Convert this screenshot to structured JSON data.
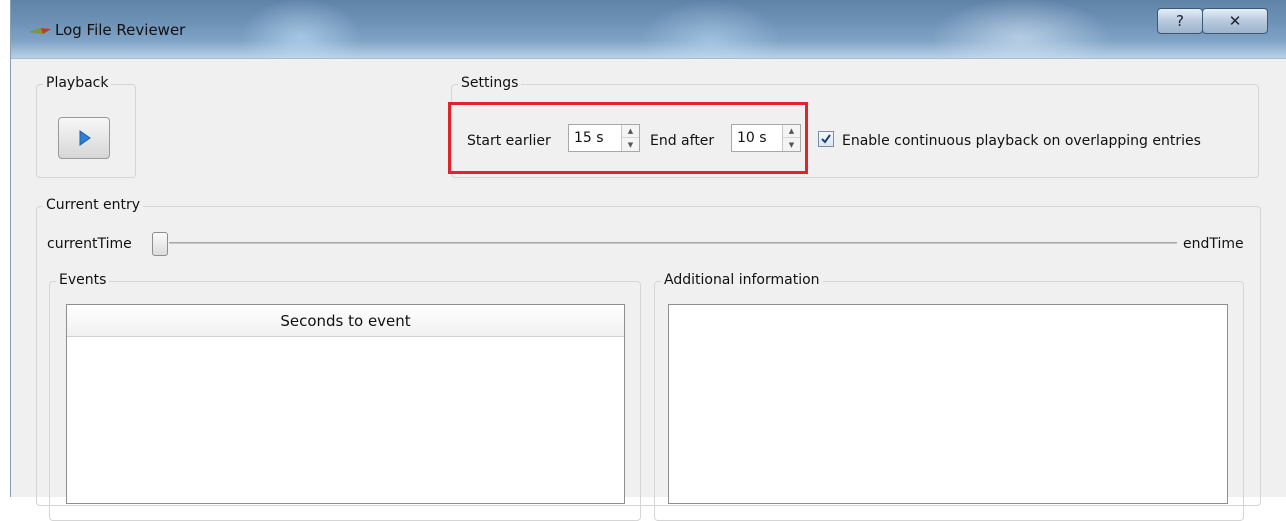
{
  "window": {
    "title": "Log File Reviewer",
    "help_glyph": "?",
    "close_glyph": "✕"
  },
  "playback": {
    "group_title": "Playback",
    "play_icon": "play-icon"
  },
  "settings": {
    "group_title": "Settings",
    "start_earlier_label": "Start earlier",
    "start_earlier_value": "15 s",
    "end_after_label": "End after",
    "end_after_value": "10 s",
    "continuous_label": "Enable continuous playback on overlapping entries",
    "continuous_checked": true
  },
  "current_entry": {
    "group_title": "Current entry",
    "current_time_label": "currentTime",
    "end_time_label": "endTime",
    "slider_position": 0
  },
  "events": {
    "group_title": "Events",
    "column_header": "Seconds to event"
  },
  "additional": {
    "group_title": "Additional information"
  },
  "colors": {
    "highlight": "#e0242c",
    "play_accent": "#2f7fd6"
  }
}
